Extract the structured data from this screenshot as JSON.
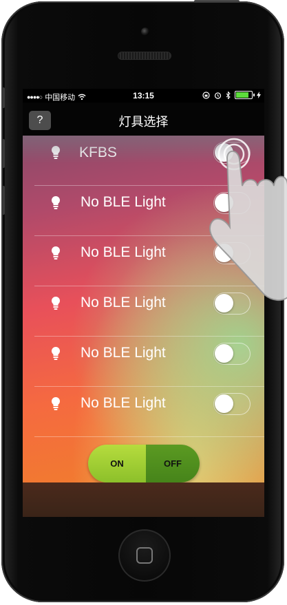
{
  "status_bar": {
    "carrier": "中国移动",
    "time": "13:15"
  },
  "nav": {
    "help_label": "?",
    "title": "灯具选择"
  },
  "lights": [
    {
      "name": "KFBS",
      "on": false
    },
    {
      "name": "No BLE Light",
      "on": false
    },
    {
      "name": "No BLE Light",
      "on": false
    },
    {
      "name": "No BLE Light",
      "on": false
    },
    {
      "name": "No BLE Light",
      "on": false
    },
    {
      "name": "No BLE Light",
      "on": false
    }
  ],
  "master_switch": {
    "on_label": "ON",
    "off_label": "OFF"
  },
  "icons": [
    "signal-dots-icon",
    "wifi-icon",
    "rotation-lock-icon",
    "alarm-icon",
    "bluetooth-icon",
    "battery-icon",
    "charging-icon",
    "lightbulb-icon",
    "tap-gesture-hand-icon"
  ],
  "colors": {
    "switch_on": "#9cce32",
    "switch_off": "#4f8e1e",
    "battery": "#5ddc3c"
  }
}
